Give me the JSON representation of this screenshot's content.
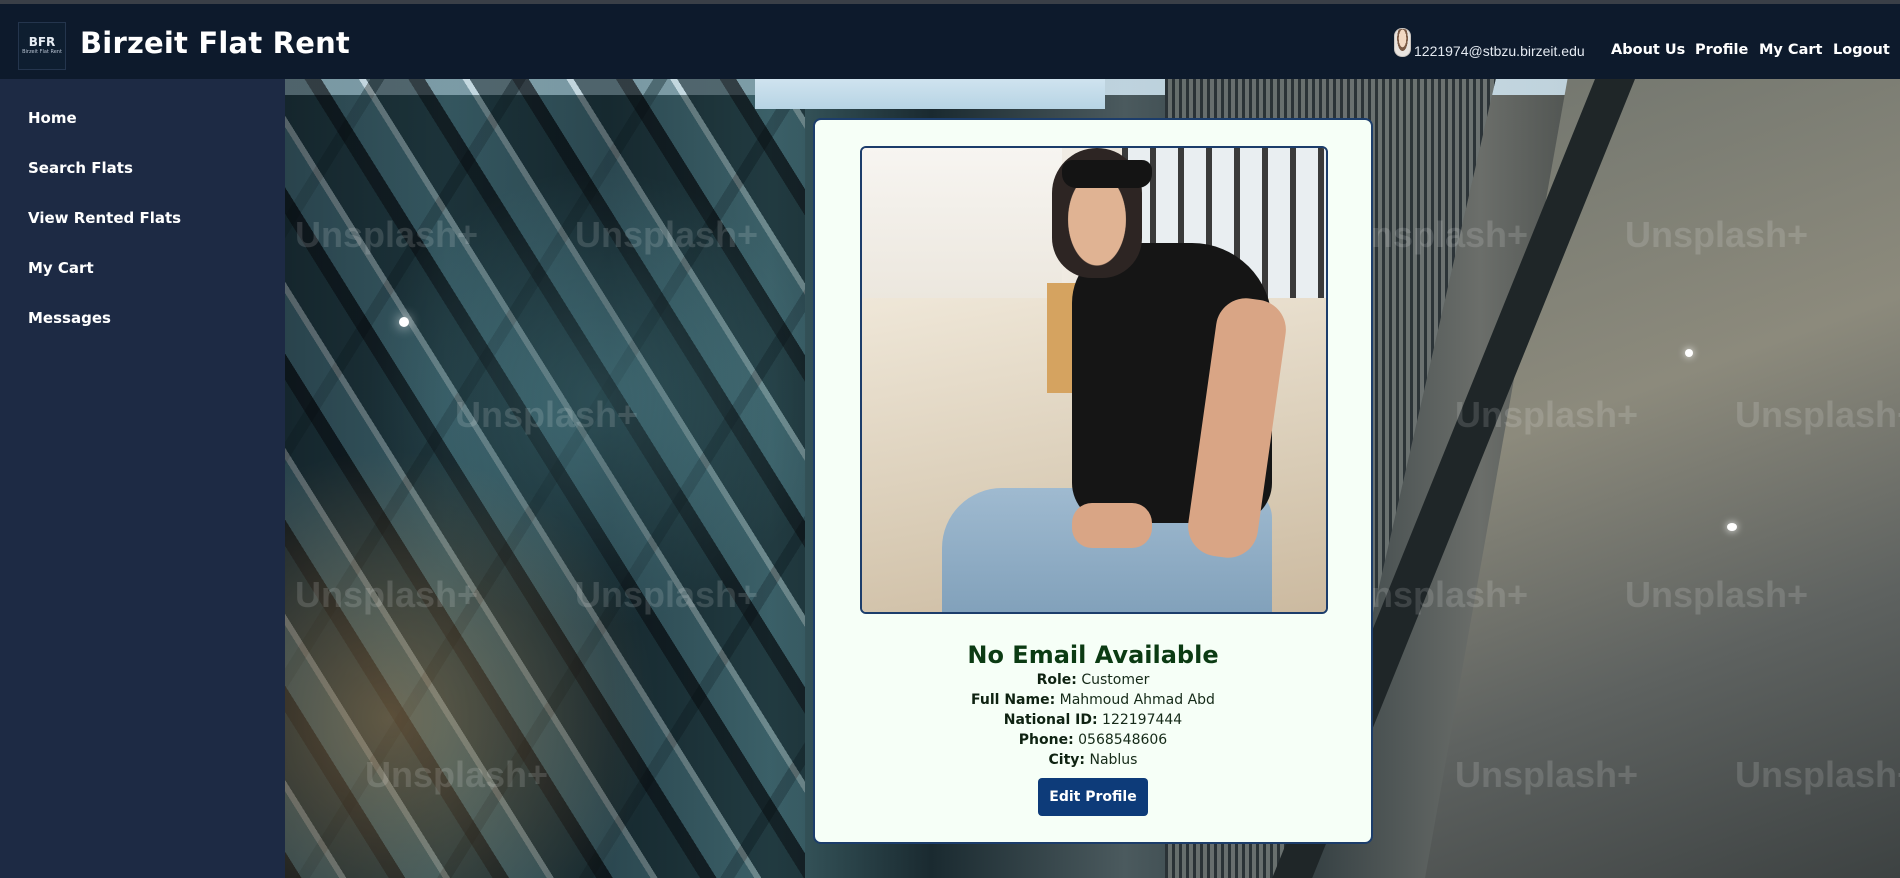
{
  "header": {
    "logo_text": "BFR",
    "logo_subtext": "Birzeit Flat Rent",
    "site_title": "Birzeit Flat Rent",
    "user_email": "1221974@stbzu.birzeit.edu",
    "nav": {
      "about": "About Us",
      "profile": "Profile",
      "cart": "My Cart",
      "logout": "Logout"
    }
  },
  "sidebar": {
    "items": [
      {
        "label": "Home"
      },
      {
        "label": "Search Flats"
      },
      {
        "label": "View Rented Flats"
      },
      {
        "label": "My Cart"
      },
      {
        "label": "Messages"
      }
    ]
  },
  "background": {
    "watermark": "Unsplash+"
  },
  "profile": {
    "heading": "No Email Available",
    "role_label": "Role:",
    "role": "Customer",
    "name_label": "Full Name:",
    "name": "Mahmoud Ahmad Abd",
    "national_id_label": "National ID:",
    "national_id": "122197444",
    "phone_label": "Phone:",
    "phone": "0568548606",
    "city_label": "City:",
    "city": "Nablus",
    "edit_button": "Edit Profile"
  },
  "colors": {
    "header_bg": "#0d1a2c",
    "sidebar_bg": "#1d2a44",
    "card_bg": "#f6fff7",
    "card_border": "#1c3d6b",
    "button_bg": "#0d3b79",
    "heading_color": "#0b3b13"
  }
}
